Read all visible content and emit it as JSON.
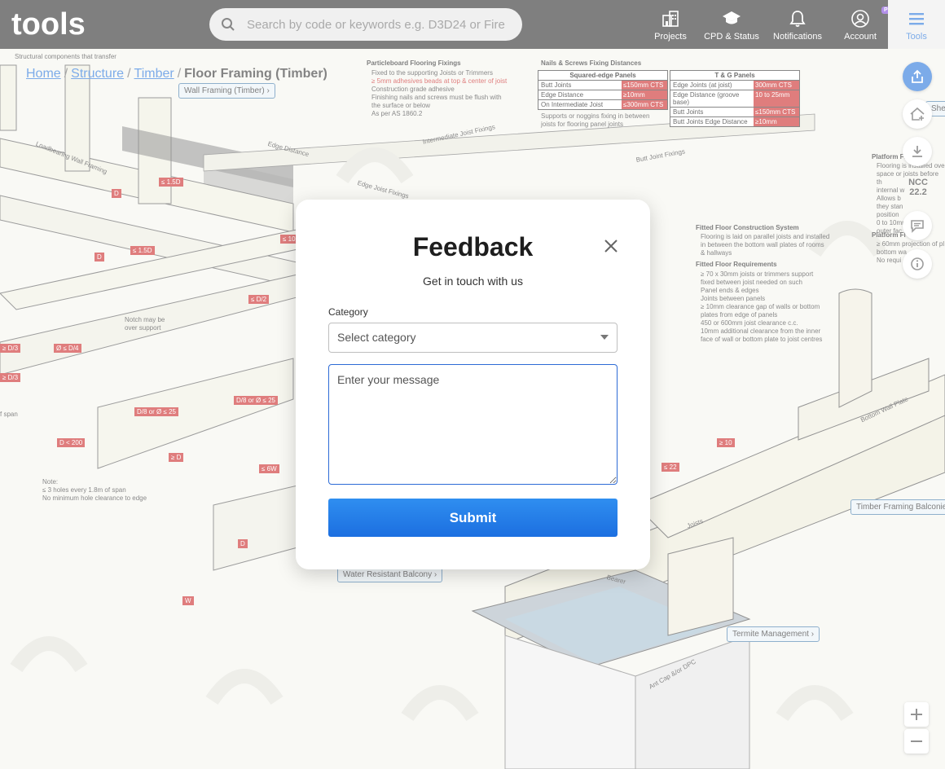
{
  "app": {
    "logo_text": "tools"
  },
  "search": {
    "placeholder": "Search by code or keywords e.g. D3D24 or Fire",
    "icon": "search-icon"
  },
  "nav": [
    {
      "label": "Projects",
      "icon": "projects-icon"
    },
    {
      "label": "CPD & Status",
      "icon": "graduation-cap-icon"
    },
    {
      "label": "Notifications",
      "icon": "bell-icon"
    },
    {
      "label": "Account",
      "icon": "account-icon",
      "badge": "PRO"
    },
    {
      "label": "Tools",
      "icon": "menu-icon",
      "active": true
    }
  ],
  "breadcrumb": {
    "items": [
      "Home",
      "Structure",
      "Timber"
    ],
    "current": "Floor Framing (Timber)"
  },
  "background": {
    "tags": [
      "Wall Framing (Timber)",
      "Water Resistant Balcony",
      "Termite Management",
      "Timber Framing Balconie",
      "Shee"
    ],
    "header_note": "Structural components that transfer",
    "particleboard": {
      "title": "Particleboard Flooring Fixings",
      "lines": [
        "Fixed to the supporting Joists or Trimmers",
        "≥ 5mm adhesives beads at top & center of joist",
        "Construction grade adhesive",
        "Finishing nails and screws must be flush with",
        "the surface or below",
        "As per AS 1860.2"
      ]
    },
    "nails": {
      "title": "Nails & Screws Fixing Distances",
      "squared_title": "Squared-edge Panels",
      "squared_rows": [
        [
          "Butt Joints",
          "≤150mm CTS"
        ],
        [
          "Edge Distance",
          "≥10mm"
        ],
        [
          "On Intermediate Joist",
          "≤300mm CTS"
        ]
      ],
      "tg_title": "T & G Panels",
      "tg_rows": [
        [
          "Edge Joints (at joist)",
          "300mm CTS"
        ],
        [
          "Edge Distance (groove base)",
          "10 to 25mm"
        ],
        [
          "Butt Joints",
          "≤150mm CTS"
        ],
        [
          "Butt Joints Edge Distance",
          "≥10mm"
        ]
      ],
      "note": "Supports or noggins fixing in between joists for flooring panel joints"
    },
    "fitted": {
      "title": "Fitted Floor Construction System",
      "lines": [
        "Flooring is laid on parallel joists and installed",
        "in between the bottom wall plates of rooms",
        "& hallways"
      ],
      "req_title": "Fitted Floor Requirements",
      "req_lines": [
        "≥ 70 x 30mm joists or trimmers support",
        "fixed between joist needed on such",
        "Panel ends & edges",
        "Joints between panels",
        "≥ 10mm clearance gap of walls or bottom",
        "plates from edge of panels",
        "450 or 600mm joist clearance c.c.",
        "10mm additional clearance from the inner",
        "face of wall or bottom plate to joist centres"
      ]
    },
    "platform": {
      "title1": "Platform Fl",
      "lines1": [
        "Flooring is installed ove",
        "space or joists before th",
        "internal w",
        "Allows b",
        "they stan",
        "position",
        "0 to 10mm",
        "outer fac"
      ],
      "title2": "Platform Fl",
      "lines2": [
        "≥ 60mm projection of pl",
        "bottom wa",
        "No requi"
      ]
    },
    "labels": [
      "Loadbearing Wall Framing",
      "Edge Distance",
      "Intermediate Joist Fixings",
      "Edge Joist Fixings",
      "Butt Joint Fixings",
      "Notch may be over support",
      "Bottom Wall Plate",
      "Joists",
      "Ant Cap &/or DPC",
      "Bearer"
    ],
    "note": {
      "title": "Note:",
      "lines": [
        "≤ 3 holes every 1.8m of span",
        "No minimum hole clearance to edge"
      ]
    },
    "span_text": "f span",
    "red_tags": [
      "D",
      "≤ 1.5D",
      "≥ D/3",
      "Ø ≤ D/4",
      "≥ D/3",
      "≤ D/2",
      "≤ 10",
      "D/8 or Ø ≤ 25",
      "D/8 or Ø ≤ 25",
      "≥ D",
      "D < 200",
      "D",
      "≤ 6W",
      "W",
      "≥ 10",
      "≤ 22",
      "D",
      "≤ 1.5D"
    ]
  },
  "rail": {
    "ncc_label": "NCC",
    "ncc_version": "22.2"
  },
  "modal": {
    "title": "Feedback",
    "subtitle": "Get in touch with us",
    "category_label": "Category",
    "category_placeholder": "Select category",
    "message_placeholder": "Enter your message",
    "submit_label": "Submit"
  },
  "colors": {
    "accent": "#1e6fd9",
    "topbar": "#232323",
    "warning_red": "#c8201f"
  }
}
